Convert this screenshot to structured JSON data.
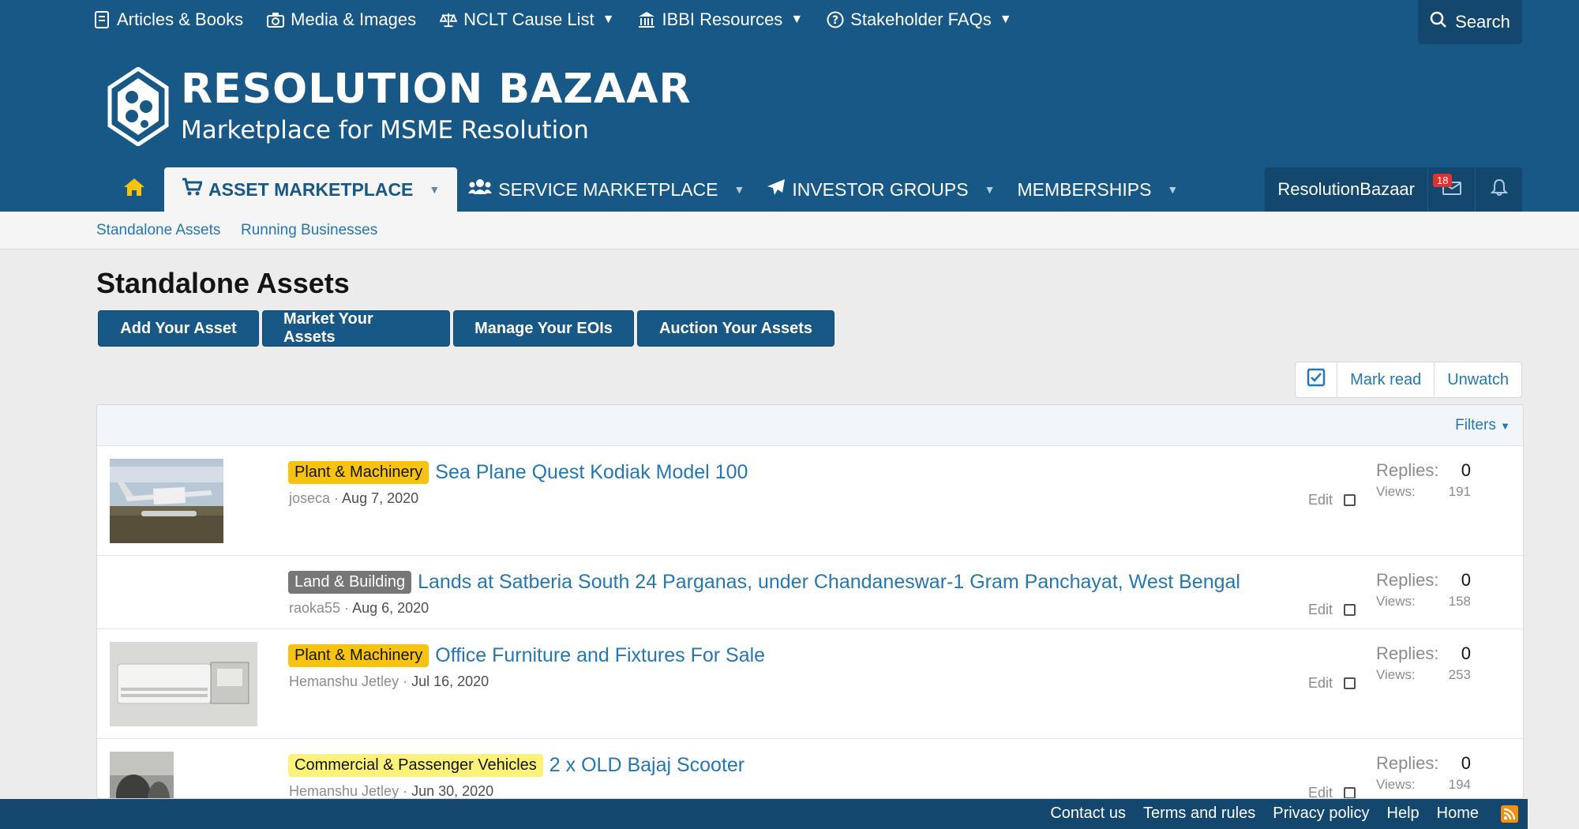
{
  "topnav": {
    "items": [
      {
        "label": "Articles & Books",
        "icon": "book-icon"
      },
      {
        "label": "Media & Images",
        "icon": "camera-icon"
      },
      {
        "label": "NCLT Cause List",
        "icon": "scale-icon",
        "dropdown": true
      },
      {
        "label": "IBBI Resources",
        "icon": "bank-icon",
        "dropdown": true
      },
      {
        "label": "Stakeholder FAQs",
        "icon": "question-icon",
        "dropdown": true
      }
    ],
    "search_label": "Search"
  },
  "logo": {
    "title": "RESOLUTION BAZAAR",
    "subtitle": "Marketplace for MSME Resolution"
  },
  "mainnav": {
    "items": [
      {
        "label": "Asset Marketplace",
        "icon": "cart-icon",
        "active": true
      },
      {
        "label": "Service Marketplace",
        "icon": "users-icon"
      },
      {
        "label": "Investor Groups",
        "icon": "paper-plane-icon"
      },
      {
        "label": "Memberships"
      }
    ],
    "username": "ResolutionBazaar",
    "inbox_count": "18"
  },
  "subnav": {
    "links": [
      "Standalone Assets",
      "Running Businesses"
    ]
  },
  "page": {
    "title": "Standalone Assets",
    "buttons": [
      "Add Your Asset",
      "Market Your Assets",
      "Manage Your EOIs",
      "Auction Your Assets"
    ],
    "mark_read": "Mark read",
    "unwatch": "Unwatch",
    "filters": "Filters"
  },
  "threads": [
    {
      "prefix": "Plant & Machinery",
      "title": "Sea Plane Quest Kodiak Model 100",
      "author": "joseca",
      "date": "Aug 7, 2020",
      "edit": "Edit",
      "replies_label": "Replies:",
      "replies": "0",
      "views_label": "Views:",
      "views": "191"
    },
    {
      "prefix": "Land & Building",
      "title": "Lands at Satberia South 24 Parganas, under Chandaneswar-1 Gram Panchayat, West Bengal",
      "author": "raoka55",
      "date": "Aug 6, 2020",
      "edit": "Edit",
      "replies_label": "Replies:",
      "replies": "0",
      "views_label": "Views:",
      "views": "158"
    },
    {
      "prefix": "Plant & Machinery",
      "title": "Office Furniture and Fixtures For Sale",
      "author": "Hemanshu Jetley",
      "date": "Jul 16, 2020",
      "edit": "Edit",
      "replies_label": "Replies:",
      "replies": "0",
      "views_label": "Views:",
      "views": "253"
    },
    {
      "prefix": "Commercial & Passenger Vehicles",
      "title": "2 x OLD Bajaj Scooter",
      "author": "Hemanshu Jetley",
      "date": "Jun 30, 2020",
      "edit": "Edit",
      "replies_label": "Replies:",
      "replies": "0",
      "views_label": "Views:",
      "views": "194"
    }
  ],
  "footer": {
    "links": [
      "Contact us",
      "Terms and rules",
      "Privacy policy",
      "Help",
      "Home"
    ]
  }
}
